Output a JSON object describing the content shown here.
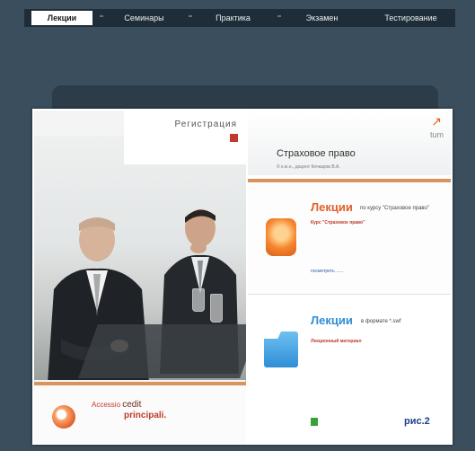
{
  "nav": {
    "tabs": [
      "Лекции",
      "Семинары",
      "Практика",
      "Экзамен",
      "Тестирование"
    ]
  },
  "left_panel": {
    "registration": "Регистрация",
    "banner": {
      "word1": "Accessio",
      "word2": "cedit",
      "word3": "principali."
    }
  },
  "right_panel": {
    "logo": "tum",
    "title": "Страховое право",
    "subtitle": "© к.ю.н., доцент Кочкаров В.А.",
    "lectures_course": {
      "heading": "Лекции",
      "heading_suffix": "по курсу \"Страховое право\"",
      "course_label": "Курс \"Страховое право\"",
      "more_link": "посмотреть ......"
    },
    "lectures_swf": {
      "heading": "Лекции",
      "heading_suffix": "в формате *.swf",
      "material_label": "Лекционный материал",
      "caption": "рис.2"
    }
  },
  "colors": {
    "background": "#3b4e5e",
    "nav_bar": "#1e2d38",
    "accent_orange": "#e2602a",
    "accent_blue": "#2f8ed6",
    "divider": "#d9935e"
  }
}
